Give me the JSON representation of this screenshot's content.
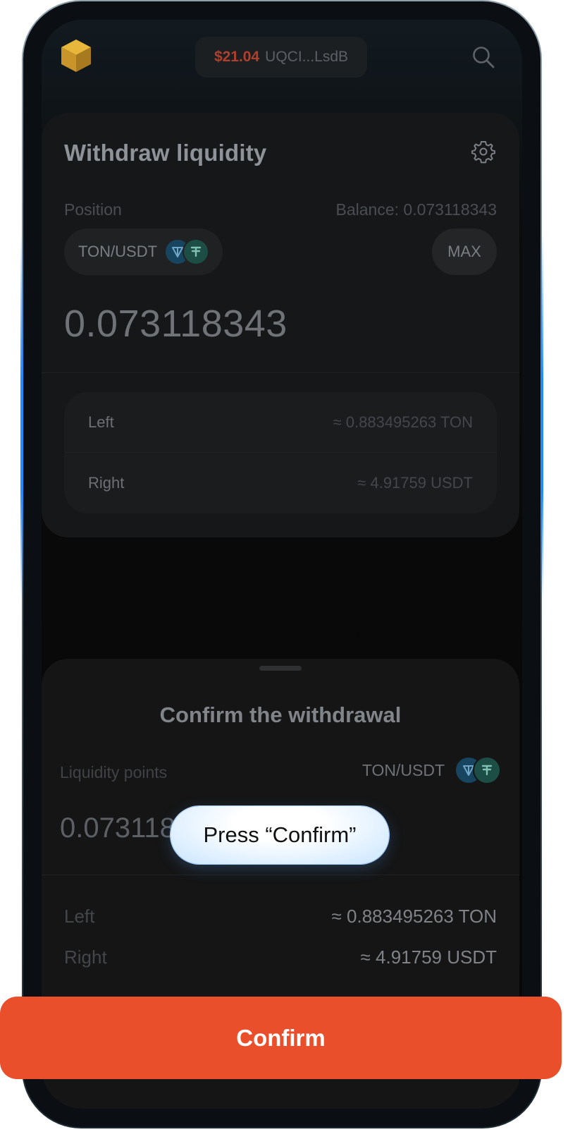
{
  "header": {
    "wallet_balance": "$21.04",
    "wallet_address": "UQCI...LsdB"
  },
  "withdraw_card": {
    "title": "Withdraw liquidity",
    "position_label": "Position",
    "balance_label": "Balance: 0.073118343",
    "pair": "TON/USDT",
    "max_label": "MAX",
    "amount": "0.073118343",
    "left_label": "Left",
    "left_value": "≈ 0.883495263 TON",
    "right_label": "Right",
    "right_value": "≈ 4.91759 USDT"
  },
  "sheet": {
    "title": "Confirm the withdrawal",
    "liquidity_points_label": "Liquidity points",
    "pair": "TON/USDT",
    "amount_partial": "0.073118",
    "left_label": "Left",
    "left_value": "≈ 0.883495263 TON",
    "right_label": "Right",
    "right_value": "≈ 4.91759 USDT"
  },
  "tooltip": {
    "text": "Press “Confirm”"
  },
  "confirm_button": {
    "label": "Confirm"
  },
  "colors": {
    "accent": "#ea4f2c",
    "balance_red": "#b0402b",
    "ton_blue": "#17445f",
    "usdt_green": "#1c4e46"
  }
}
